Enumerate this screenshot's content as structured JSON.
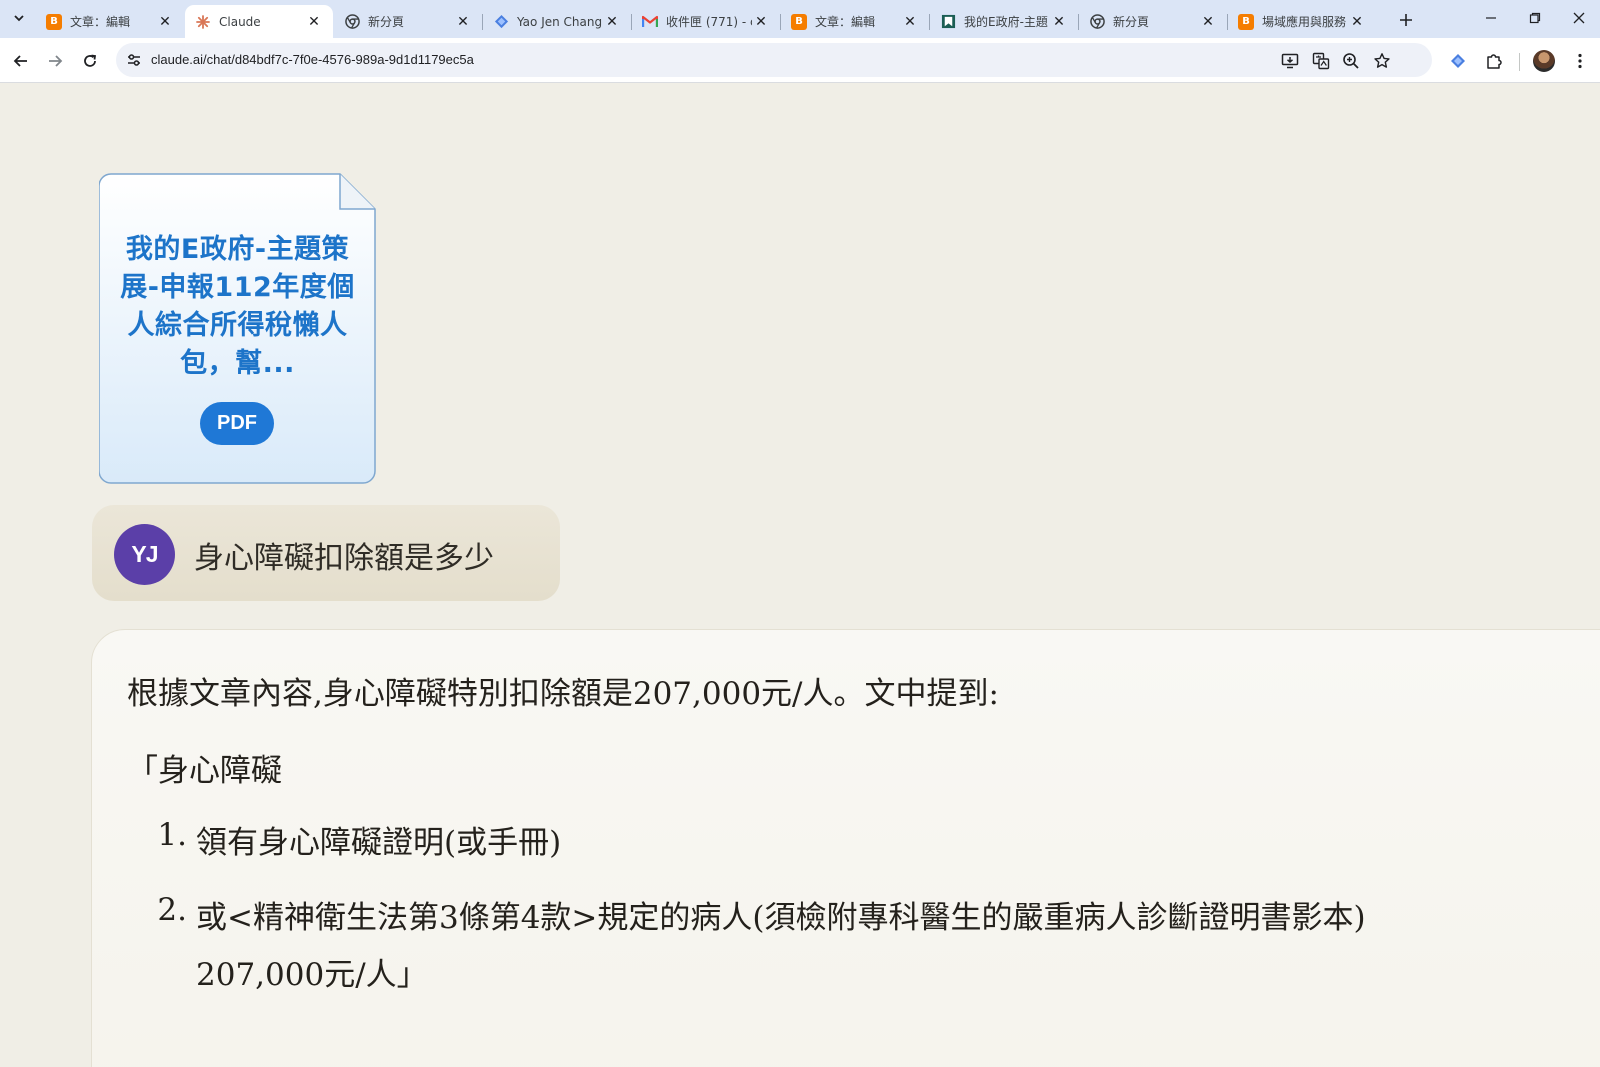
{
  "browser": {
    "tabs": [
      {
        "title": "文章：編輯",
        "favicon": "blogger-icon",
        "active": false
      },
      {
        "title": "Claude",
        "favicon": "claude-icon",
        "active": true
      },
      {
        "title": "新分頁",
        "favicon": "chrome-icon",
        "active": false
      },
      {
        "title": "Yao Jen Chang",
        "favicon": "gemini-icon",
        "active": false
      },
      {
        "title": "收件匣 (771) - c",
        "favicon": "gmail-icon",
        "active": false
      },
      {
        "title": "文章：編輯",
        "favicon": "blogger-icon",
        "active": false
      },
      {
        "title": "我的E政府-主題",
        "favicon": "bookmark-flag-icon",
        "active": false
      },
      {
        "title": "新分頁",
        "favicon": "chrome-icon",
        "active": false
      },
      {
        "title": "場域應用與服務",
        "favicon": "blogger-icon",
        "active": false
      }
    ],
    "url": "claude.ai/chat/d84bdf7c-7f0e-4576-989a-9d1d1179ec5a",
    "colors": {
      "tabstrip": "#dbe5f6",
      "blogger": "#f57d00",
      "gmail_red": "#ea4335"
    }
  },
  "chat": {
    "attachment": {
      "title": "我的E政府-主題策展-申報112年度個人綜合所得稅懶人包，幫...",
      "type_label": "PDF"
    },
    "user_message": {
      "avatar_initials": "YJ",
      "text": "身心障礙扣除額是多少"
    },
    "assistant_message": {
      "intro": "根據文章內容,身心障礙特別扣除額是207,000元/人。文中提到:",
      "quote_start": "「身心障礙",
      "list": [
        {
          "num": "1.",
          "lines": [
            "領有身心障礙證明(或手冊)"
          ]
        },
        {
          "num": "2.",
          "lines": [
            "或<精神衛生法第3條第4款>規定的病人(須檢附專科醫生的嚴重病人診斷證明書影本)",
            "207,000元/人」"
          ]
        }
      ]
    },
    "colors": {
      "background": "#f0eee6",
      "pdf_blue": "#1f78d6",
      "avatar": "#5b3fa8"
    }
  }
}
